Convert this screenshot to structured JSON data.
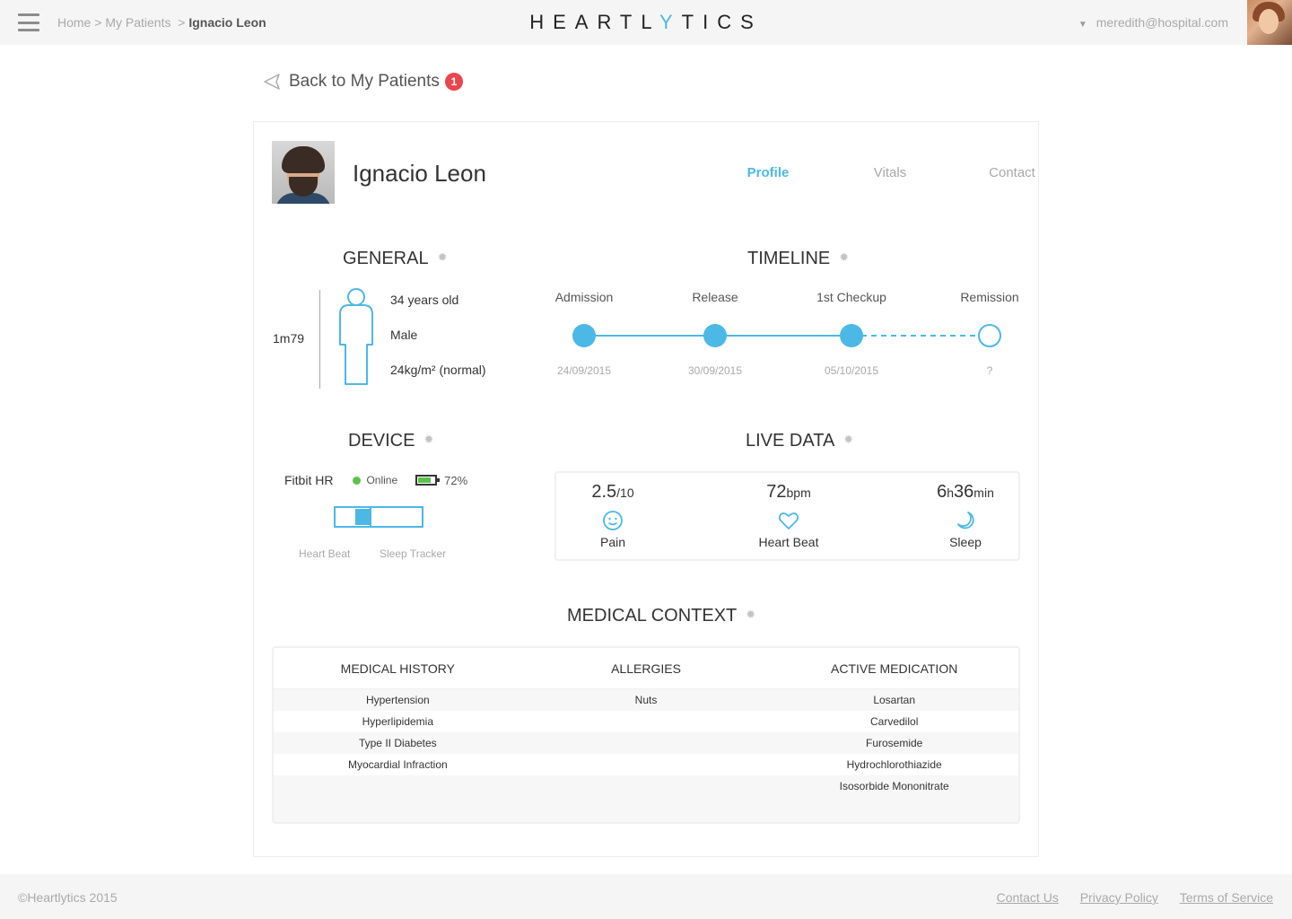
{
  "header": {
    "brand_prefix": "HEARTL",
    "brand_y": "Y",
    "brand_suffix": "TICS",
    "breadcrumb": [
      "Home",
      "My Patients",
      "Ignacio Leon"
    ],
    "breadcrumb_sep": ">",
    "user_email": "meredith@hospital.com"
  },
  "back": {
    "label": "Back to My Patients",
    "badge": "1"
  },
  "patient": {
    "name": "Ignacio Leon",
    "tabs": [
      {
        "label": "Profile",
        "active": true
      },
      {
        "label": "Vitals",
        "active": false
      },
      {
        "label": "Contact",
        "active": false
      }
    ]
  },
  "general": {
    "title": "GENERAL",
    "height": "1m79",
    "age": "34 years old",
    "sex": "Male",
    "bmi": "24kg/m² (normal)"
  },
  "timeline": {
    "title": "TIMELINE",
    "steps": [
      {
        "label": "Admission",
        "date": "24/09/2015",
        "done": true
      },
      {
        "label": "Release",
        "date": "30/09/2015",
        "done": true
      },
      {
        "label": "1st Checkup",
        "date": "05/10/2015",
        "done": true
      },
      {
        "label": "Remission",
        "date": "?",
        "done": false
      }
    ]
  },
  "device": {
    "title": "DEVICE",
    "name": "Fitbit HR",
    "status": "Online",
    "battery": "72%",
    "battery_level": 0.72,
    "modes": [
      "Heart Beat",
      "Sleep Tracker"
    ]
  },
  "live_data": {
    "title": "LIVE DATA",
    "items": [
      {
        "value": "2.5",
        "unit": "/10",
        "label": "Pain",
        "icon": "smiley-icon"
      },
      {
        "value": "72",
        "unit": "bpm",
        "label": "Heart Beat",
        "icon": "heart-icon"
      },
      {
        "value_h": "6",
        "unit_h": "h",
        "value_m": "36",
        "unit_m": "min",
        "label": "Sleep",
        "icon": "moon-icon"
      }
    ]
  },
  "medical": {
    "title": "MEDICAL CONTEXT",
    "columns": [
      "MEDICAL HISTORY",
      "ALLERGIES",
      "ACTIVE MEDICATION"
    ],
    "rows": [
      [
        "Hypertension",
        "Nuts",
        "Losartan"
      ],
      [
        "Hyperlipidemia",
        "",
        "Carvedilol"
      ],
      [
        "Type II Diabetes",
        "",
        "Furosemide"
      ],
      [
        "Myocardial Infraction",
        "",
        "Hydrochlorothiazide"
      ],
      [
        "",
        "",
        "Isosorbide Mononitrate"
      ]
    ]
  },
  "footer": {
    "copyright": "©Heartlytics 2015",
    "links": [
      "Contact Us",
      "Privacy Policy",
      "Terms of Service"
    ]
  },
  "colors": {
    "accent": "#4cb8e6",
    "badge": "#e8474f",
    "online": "#5cc24a"
  }
}
